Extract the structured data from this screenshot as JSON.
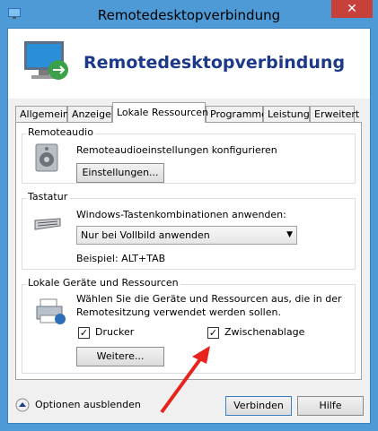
{
  "window": {
    "title": "Remotedesktopverbindung",
    "close_label": "✕"
  },
  "banner": {
    "title": "Remotedesktopverbindung"
  },
  "tabs": [
    {
      "label": "Allgemein"
    },
    {
      "label": "Anzeige"
    },
    {
      "label": "Lokale Ressourcen"
    },
    {
      "label": "Programme"
    },
    {
      "label": "Leistung"
    },
    {
      "label": "Erweitert"
    }
  ],
  "remoteaudio": {
    "group_label": "Remoteaudio",
    "description": "Remoteaudioeinstellungen konfigurieren",
    "settings_button": "Einstellungen..."
  },
  "tastatur": {
    "group_label": "Tastatur",
    "description": "Windows-Tastenkombinationen anwenden:",
    "select_value": "Nur bei Vollbild anwenden",
    "example": "Beispiel: ALT+TAB"
  },
  "lokale": {
    "group_label": "Lokale Geräte und Ressourcen",
    "description_line1": "Wählen Sie die Geräte und Ressourcen aus, die in der",
    "description_line2": "Remotesitzung verwendet werden sollen.",
    "drucker_label": "Drucker",
    "drucker_checked": true,
    "zwischenablage_label": "Zwischenablage",
    "zwischenablage_checked": true,
    "more_button": "Weitere..."
  },
  "footer": {
    "options_label": "Optionen ausblenden",
    "connect_button": "Verbinden",
    "help_button": "Hilfe"
  },
  "colors": {
    "accent": "#1d3a8a",
    "frame": "#4e9ad6",
    "close": "#c7413b",
    "arrow": "#e8221c"
  }
}
